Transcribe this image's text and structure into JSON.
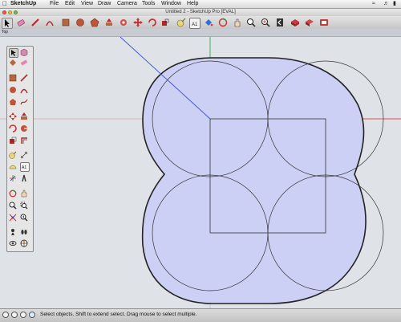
{
  "menubar": {
    "apple_icon": "apple-icon",
    "app_name": "SketchUp",
    "items": [
      "File",
      "Edit",
      "View",
      "Draw",
      "Camera",
      "Tools",
      "Window",
      "Help"
    ]
  },
  "window": {
    "title": "Untitled 2 - SketchUp Pro [EVAL]"
  },
  "scene_tab": {
    "label": "Top"
  },
  "status_bar": {
    "text": "Select objects. Shift to extend select. Drag mouse to select multiple."
  },
  "colors": {
    "face_fill": "#cdd0f5",
    "edge": "#222222",
    "axis_red": "#e05050",
    "axis_green": "#2fa84f",
    "axis_blue": "#3a4fd8",
    "background": "#dfe3e8"
  }
}
